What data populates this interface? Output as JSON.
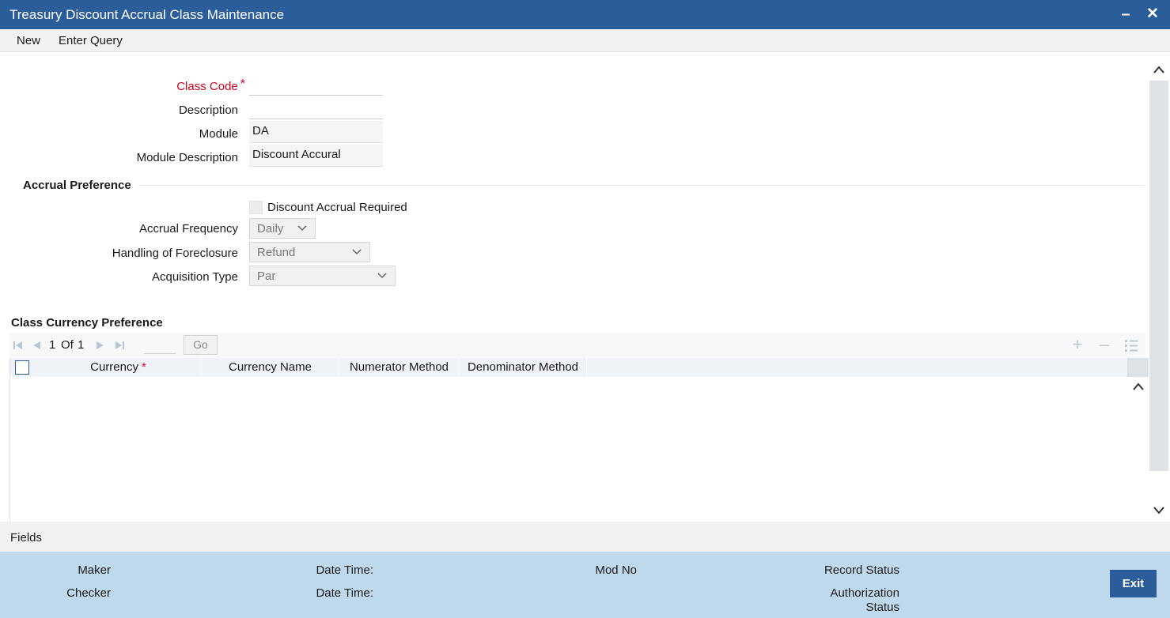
{
  "window": {
    "title": "Treasury Discount Accrual Class Maintenance",
    "minimize": "–",
    "close": "✕"
  },
  "menu": {
    "new": "New",
    "enter_query": "Enter Query"
  },
  "form": {
    "class_code": {
      "label": "Class Code",
      "required_mark": "*",
      "value": ""
    },
    "description": {
      "label": "Description",
      "value": ""
    },
    "module": {
      "label": "Module",
      "value": "DA"
    },
    "module_description": {
      "label": "Module Description",
      "value": "Discount Accural"
    }
  },
  "accrual_preference": {
    "title": "Accrual Preference",
    "discount_accrual_required": {
      "label": "Discount Accrual Required",
      "checked": false
    },
    "accrual_frequency": {
      "label": "Accrual Frequency",
      "value": "Daily"
    },
    "handling_of_foreclosure": {
      "label": "Handling of Foreclosure",
      "value": "Refund"
    },
    "acquisition_type": {
      "label": "Acquisition Type",
      "value": "Par"
    }
  },
  "class_currency": {
    "title": "Class Currency Preference",
    "pagination": {
      "current": "1",
      "of_label": "Of",
      "total": "1",
      "go_label": "Go"
    },
    "columns": [
      {
        "label": "Currency",
        "required_mark": "*"
      },
      {
        "label": "Currency Name"
      },
      {
        "label": "Numerator Method"
      },
      {
        "label": "Denominator Method"
      }
    ],
    "rows": []
  },
  "fields_bar": {
    "label": "Fields"
  },
  "footer": {
    "maker": "Maker",
    "checker": "Checker",
    "date_time_1": "Date Time:",
    "date_time_2": "Date Time:",
    "mod_no": "Mod No",
    "record_status": "Record Status",
    "authorization_status_1": "Authorization",
    "authorization_status_2": "Status",
    "exit": "Exit"
  },
  "colors": {
    "title_bar": "#2c5d9b",
    "required": "#d6001c",
    "footer": "#bed8ec"
  }
}
